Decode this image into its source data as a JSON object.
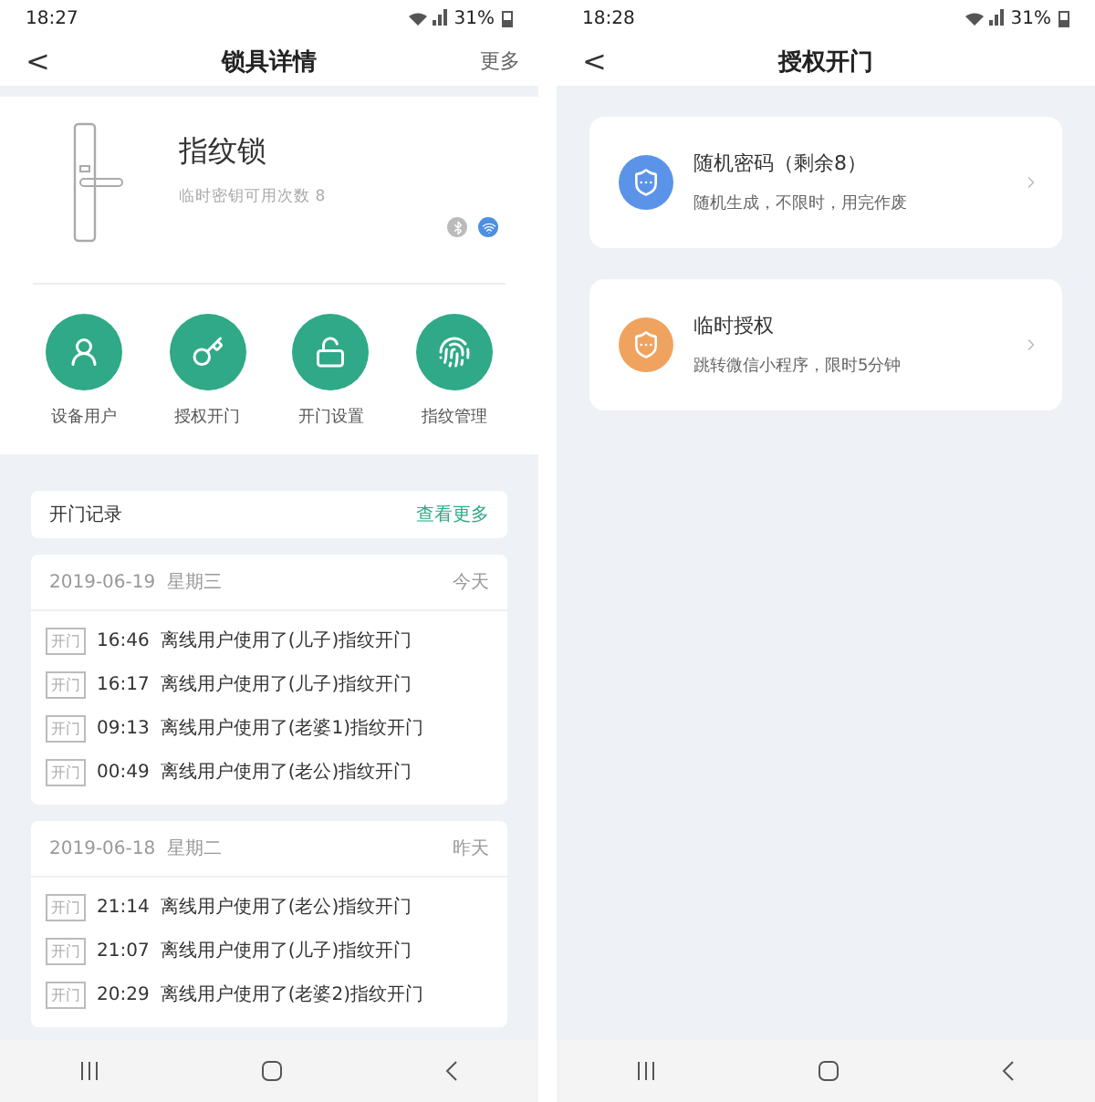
{
  "left_screen": {
    "status_bar": {
      "time": "18:27",
      "battery": "31%"
    },
    "header": {
      "back": "<",
      "title": "锁具详情",
      "action": "更多"
    },
    "lock": {
      "name": "指纹锁",
      "subtitle": "临时密钥可用次数 8",
      "bluetooth_on": false,
      "wifi_on": true
    },
    "actions": [
      {
        "kind": "users",
        "label": "设备用户"
      },
      {
        "kind": "key",
        "label": "授权开门"
      },
      {
        "kind": "lock",
        "label": "开门设置"
      },
      {
        "kind": "fingerprint",
        "label": "指纹管理"
      }
    ],
    "records": {
      "title": "开门记录",
      "more": "查看更多",
      "days": [
        {
          "date": "2019-06-19",
          "weekday": "星期三",
          "relative": "今天",
          "entries": [
            {
              "tag": "开门",
              "time": "16:46",
              "text": "离线用户使用了(儿子)指纹开门"
            },
            {
              "tag": "开门",
              "time": "16:17",
              "text": "离线用户使用了(儿子)指纹开门"
            },
            {
              "tag": "开门",
              "time": "09:13",
              "text": "离线用户使用了(老婆1)指纹开门"
            },
            {
              "tag": "开门",
              "time": "00:49",
              "text": "离线用户使用了(老公)指纹开门"
            }
          ]
        },
        {
          "date": "2019-06-18",
          "weekday": "星期二",
          "relative": "昨天",
          "entries": [
            {
              "tag": "开门",
              "time": "21:14",
              "text": "离线用户使用了(老公)指纹开门"
            },
            {
              "tag": "开门",
              "time": "21:07",
              "text": "离线用户使用了(儿子)指纹开门"
            },
            {
              "tag": "开门",
              "time": "20:29",
              "text": "离线用户使用了(老婆2)指纹开门"
            }
          ]
        }
      ]
    }
  },
  "right_screen": {
    "status_bar": {
      "time": "18:28",
      "battery": "31%"
    },
    "header": {
      "back": "<",
      "title": "授权开门"
    },
    "options": [
      {
        "title": "随机密码（剩余8）",
        "description": "随机生成，不限时，用完作废",
        "color": "#5b93e8"
      },
      {
        "title": "临时授权",
        "description": "跳转微信小程序，限时5分钟",
        "color": "#f0a35e"
      }
    ]
  }
}
